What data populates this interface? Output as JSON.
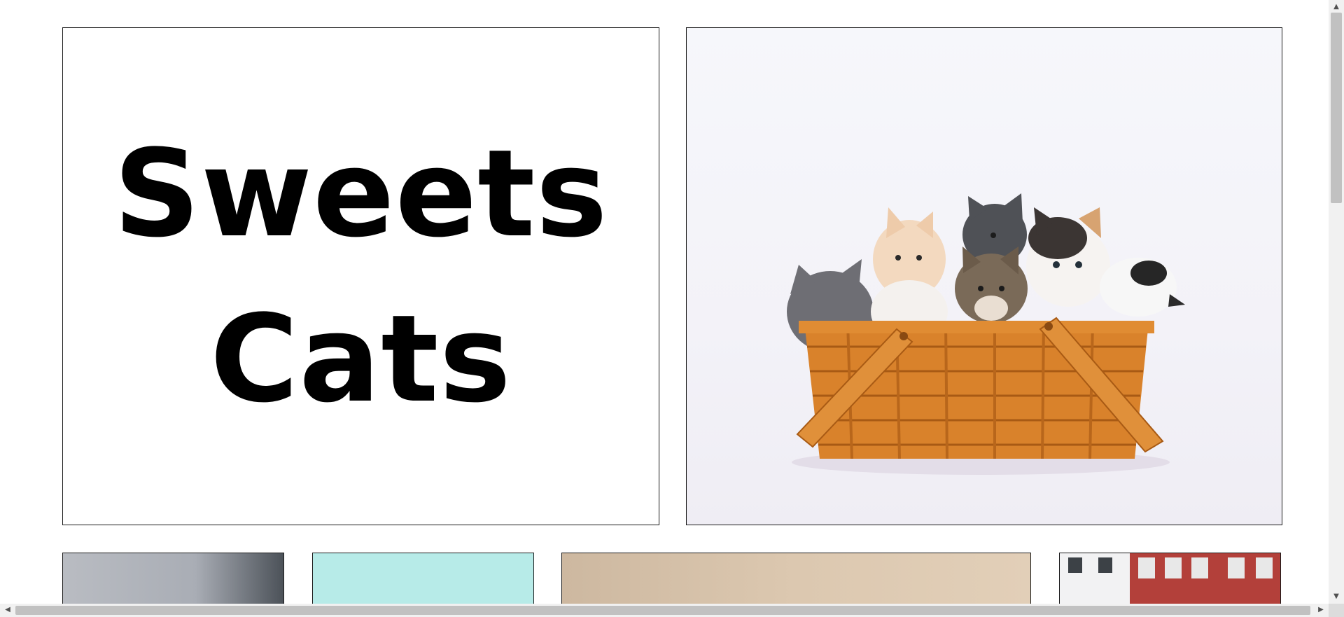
{
  "hero": {
    "title_line1": "Sweets",
    "title_line2": "Cats"
  },
  "images": {
    "hero_alt": "kittens in basket",
    "thumbnails": [
      "cat photo 1",
      "cat photo 2",
      "cat photo 3",
      "cat photo 4"
    ]
  },
  "icons": {
    "scroll_up": "▲",
    "scroll_down": "▼",
    "scroll_left": "◀",
    "scroll_right": "▶"
  },
  "colors": {
    "basket": "#d9822b",
    "border": "#1a1a1a"
  }
}
